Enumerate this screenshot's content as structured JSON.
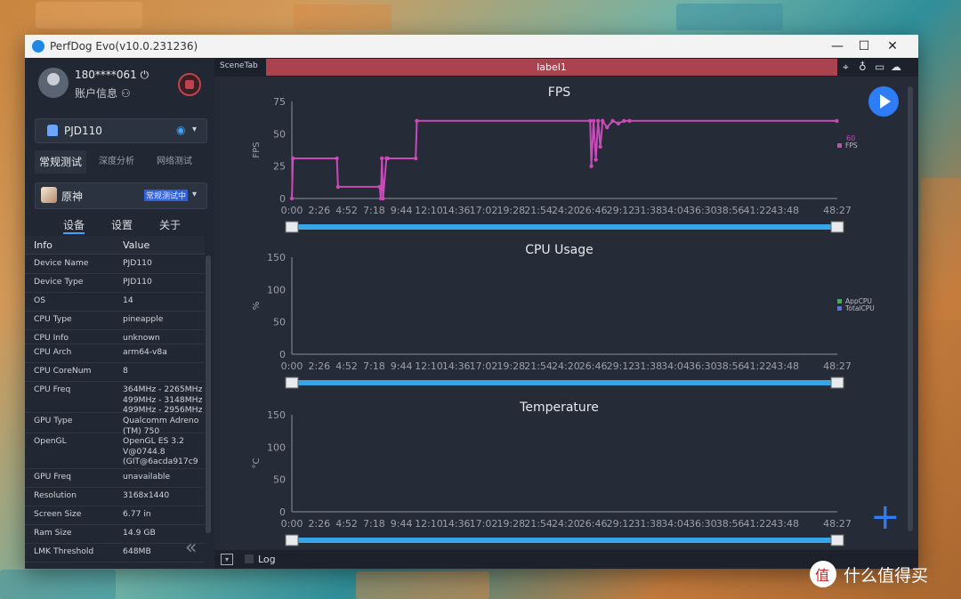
{
  "window": {
    "title": "PerfDog Evo(v10.0.231236)",
    "minimize": "—",
    "maximize": "☐",
    "close": "✕"
  },
  "account": {
    "user": "180****061 ⏻",
    "info": "账户信息 ⚇"
  },
  "device": {
    "name": "PJD110",
    "wifi": "◉",
    "caret": "▾"
  },
  "mode_tabs": [
    "常规测试",
    "深度分析",
    "网络测试"
  ],
  "app": {
    "name": "原神",
    "badge": "常规测试中",
    "caret": "▾"
  },
  "sub_tabs": [
    "设备",
    "设置",
    "关于"
  ],
  "info_table": {
    "headers": [
      "Info",
      "Value"
    ],
    "rows": [
      {
        "k": "Device Name",
        "v": "PJD110"
      },
      {
        "k": "Device Type",
        "v": "PJD110"
      },
      {
        "k": "OS",
        "v": "14"
      },
      {
        "k": "CPU Type",
        "v": "pineapple"
      },
      {
        "k": "CPU Info",
        "v": "unknown"
      },
      {
        "k": "CPU Arch",
        "v": "arm64-v8a"
      },
      {
        "k": "CPU CoreNum",
        "v": "8"
      },
      {
        "k": "CPU Freq",
        "v": "364MHz - 2265MHz\n499MHz - 3148MHz\n499MHz - 2956MHz"
      },
      {
        "k": "GPU Type",
        "v": "Qualcomm Adreno\n(TM) 750"
      },
      {
        "k": "OpenGL",
        "v": "OpenGL ES 3.2\nV@0744.8\n(GIT@6acda917c9"
      },
      {
        "k": "GPU Freq",
        "v": "unavailable"
      },
      {
        "k": "Resolution",
        "v": "3168x1440"
      },
      {
        "k": "Screen Size",
        "v": "6.77 in"
      },
      {
        "k": "Ram Size",
        "v": "14.9 GB"
      },
      {
        "k": "LMK Threshold",
        "v": "648MB"
      }
    ]
  },
  "collapse": "«",
  "scene": {
    "tab": "SceneTab",
    "label": "label1",
    "icons": [
      "location-icon",
      "pin-icon",
      "folder-icon",
      "cloud-icon"
    ],
    "icon_glyphs": [
      "⌖",
      "♁",
      "▭",
      "☁"
    ]
  },
  "footer": {
    "log": "Log",
    "dropdown": "▾"
  },
  "watermark": "什么值得买",
  "colors": {
    "fps": "#c84bb8",
    "appcpu": "#3fae5b",
    "totalcpu": "#5d6fd6",
    "slider": "#36a6e8",
    "accent": "#2e7cf6",
    "label_bar": "#a8434f"
  },
  "chart_data": [
    {
      "type": "line",
      "title": "FPS",
      "ylabel": "FPS",
      "ylim": [
        0,
        75
      ],
      "yticks": [
        0,
        25,
        50,
        75
      ],
      "xticks": [
        "0:00",
        "2:26",
        "4:52",
        "7:18",
        "9:44",
        "12:10",
        "14:36",
        "17:02",
        "19:28",
        "21:54",
        "24:20",
        "26:46",
        "29:12",
        "31:38",
        "34:04",
        "36:30",
        "38:56",
        "41:22",
        "43:48",
        "48:27"
      ],
      "current_value_label": "60",
      "series": [
        {
          "name": "FPS",
          "color": "#c84bb8",
          "x": [
            0,
            0.1,
            4.0,
            4.1,
            7.8,
            7.9,
            8.0,
            8.1,
            8.4,
            8.5,
            11.0,
            11.1,
            26.5,
            26.6,
            26.8,
            27.0,
            27.2,
            27.4,
            27.6,
            28.0,
            28.5,
            29.0,
            29.5,
            30.0,
            48.4
          ],
          "y": [
            0,
            31,
            31,
            9,
            9,
            0,
            31,
            0,
            31,
            31,
            31,
            60,
            60,
            25,
            60,
            30,
            60,
            40,
            60,
            55,
            60,
            58,
            60,
            60,
            60
          ]
        }
      ]
    },
    {
      "type": "line",
      "title": "CPU Usage",
      "ylabel": "%",
      "ylim": [
        0,
        150
      ],
      "yticks": [
        0,
        50,
        100,
        150
      ],
      "xticks": [
        "0:00",
        "2:26",
        "4:52",
        "7:18",
        "9:44",
        "12:10",
        "14:36",
        "17:02",
        "19:28",
        "21:54",
        "24:20",
        "26:46",
        "29:12",
        "31:38",
        "34:04",
        "36:30",
        "38:56",
        "41:22",
        "43:48",
        "48:27"
      ],
      "series": [
        {
          "name": "AppCPU",
          "color": "#3fae5b",
          "values": []
        },
        {
          "name": "TotalCPU",
          "color": "#5d6fd6",
          "values": []
        }
      ]
    },
    {
      "type": "line",
      "title": "Temperature",
      "ylabel": "°C",
      "ylim": [
        0,
        150
      ],
      "yticks": [
        0,
        50,
        100,
        150
      ],
      "xticks": [
        "0:00",
        "2:26",
        "4:52",
        "7:18",
        "9:44",
        "12:10",
        "14:36",
        "17:02",
        "19:28",
        "21:54",
        "24:20",
        "26:46",
        "29:12",
        "31:38",
        "34:04",
        "36:30",
        "38:56",
        "41:22",
        "43:48",
        "48:27"
      ],
      "series": []
    }
  ]
}
